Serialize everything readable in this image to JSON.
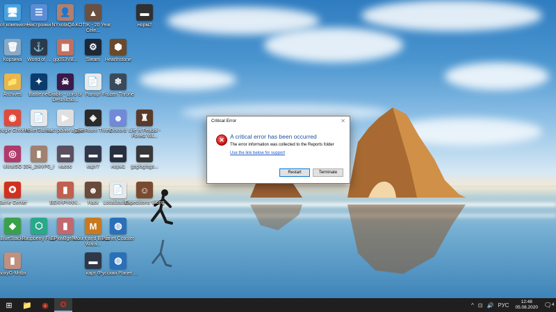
{
  "desktop": {
    "icons": [
      {
        "label": "Этот компьютер",
        "glyph": "🖥",
        "color": "#4aa3e0"
      },
      {
        "label": "Настройки",
        "glyph": "☰",
        "color": "#5b8dd6"
      },
      {
        "label": "NYxotaQA...",
        "glyph": "👤",
        "color": "#b08070"
      },
      {
        "label": "KOTIK - 20 Year Cele...",
        "glyph": "▲",
        "color": "#6a5040"
      },
      {
        "label": "норм2",
        "glyph": "▬",
        "color": "#303030"
      },
      {
        "label": "Корзина",
        "glyph": "🗑",
        "color": "#8aa9c4"
      },
      {
        "label": "World of ...",
        "glyph": "⚓",
        "color": "#2a3a4a"
      },
      {
        "label": "gq0S3VB...",
        "glyph": "▦",
        "color": "#c07060"
      },
      {
        "label": "Steam",
        "glyph": "⚙",
        "color": "#1b2838"
      },
      {
        "label": "Hearthstone",
        "glyph": "⬢",
        "color": "#6a4a2a"
      },
      {
        "label": "Archives",
        "glyph": "📁",
        "color": "#e8b84a"
      },
      {
        "label": "Battle.net",
        "glyph": "✦",
        "color": "#0a3c6e"
      },
      {
        "label": "Diablo - Lord of Destructio...",
        "glyph": "☠",
        "color": "#3a1a4a"
      },
      {
        "label": "Рапорт",
        "glyph": "📄",
        "color": "#e8e8e8"
      },
      {
        "label": "Frozen Throne",
        "glyph": "❄",
        "color": "#3a4a5a"
      },
      {
        "label": "Google Chrome",
        "glyph": "◉",
        "color": "#e04a3a"
      },
      {
        "label": "PokerStars...",
        "glyph": "📄",
        "color": "#e8e8e8"
      },
      {
        "label": "Настройки аудио",
        "glyph": "▶",
        "color": "#e0e0e0"
      },
      {
        "label": "The Room Three",
        "glyph": "◈",
        "color": "#2a2a2a"
      },
      {
        "label": "Discord",
        "glyph": "☻",
        "color": "#7289da"
      },
      {
        "label": "Life is Feudal - Forest Vill...",
        "glyph": "♜",
        "color": "#5a3a2a"
      },
      {
        "label": "UltraISO",
        "glyph": "◎",
        "color": "#b03a6a"
      },
      {
        "label": "204_2MVP0_r",
        "glyph": "▮",
        "color": "#a08070"
      },
      {
        "label": "насос",
        "glyph": "▬",
        "color": "#5a5060"
      },
      {
        "label": "карт7",
        "glyph": "▬",
        "color": "#303848"
      },
      {
        "label": "норм1",
        "glyph": "▬",
        "color": "#283040"
      },
      {
        "label": "gsgfsgfsgs...",
        "glyph": "▬",
        "color": "#383838"
      },
      {
        "label": "Game Center",
        "glyph": "✪",
        "color": "#d03020"
      },
      {
        "label": "BEKHPHNN...",
        "glyph": "▮",
        "color": "#c06050"
      },
      {
        "label": "Наск",
        "glyph": "☻",
        "color": "#6a4a3a"
      },
      {
        "label": "Localization...",
        "glyph": "📄",
        "color": "#e8e8e8"
      },
      {
        "label": "Expeditions Viking",
        "glyph": "☺",
        "color": "#7a4a30"
      },
      {
        "label": "BlueStacks",
        "glyph": "◆",
        "color": "#3aa04a"
      },
      {
        "label": "Raspberry Flow",
        "glyph": "⬡",
        "color": "#2aa88a"
      },
      {
        "label": "EPkwBgeM...",
        "glyph": "▮",
        "color": "#c06a70"
      },
      {
        "label": "Mount and Blade - Wara...",
        "glyph": "M",
        "color": "#c87a20"
      },
      {
        "label": "Planet Coaster",
        "glyph": "◍",
        "color": "#2a70b8"
      },
      {
        "label": "noxyG-Mrtbx",
        "glyph": "▮",
        "color": "#c09080"
      },
      {
        "label": "карт 6",
        "glyph": "▬",
        "color": "#303848"
      },
      {
        "label": "Русский Planet ...",
        "glyph": "◍",
        "color": "#2a70b8"
      }
    ]
  },
  "dialog": {
    "title": "Critical Error",
    "close_glyph": "✕",
    "heading": "A critical error has been occurred",
    "info": "The error information was collected to the Reports folder",
    "link": "Use the link below for support",
    "restart": "Restart",
    "terminate": "Terminate"
  },
  "taskbar": {
    "apps": [
      {
        "name": "start",
        "glyph": "⊞",
        "color": "#ffffff"
      },
      {
        "name": "file-explorer",
        "glyph": "📁",
        "color": "#f2c94c"
      },
      {
        "name": "chrome",
        "glyph": "◉",
        "color": "#e04a3a"
      },
      {
        "name": "game-app",
        "glyph": "✪",
        "color": "#d03020"
      }
    ],
    "tray_up": "^",
    "tray_network": "⊡",
    "tray_volume": "🔊",
    "tray_lang": "РУС",
    "time": "12:48",
    "date": "05.08.2020",
    "notifications_count": "4"
  }
}
